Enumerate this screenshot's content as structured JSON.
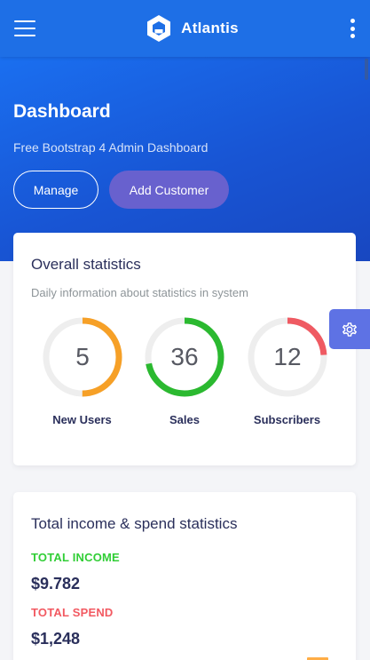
{
  "navbar": {
    "brand": "Atlantis",
    "menu_icon": "hamburger-menu-icon",
    "more_icon": "more-vertical-icon",
    "logo_icon": "atlantis-logo-icon",
    "color": "#1e6fe6"
  },
  "hero": {
    "title": "Dashboard",
    "subtitle": "Free Bootstrap 4 Admin Dashboard",
    "manage_label": "Manage",
    "add_customer_label": "Add Customer"
  },
  "stats_card": {
    "title": "Overall statistics",
    "subtitle": "Daily information about statistics in system",
    "items": [
      {
        "value": "5",
        "label": "New Users",
        "color": "#f6a027",
        "fill": 0.5
      },
      {
        "value": "36",
        "label": "Sales",
        "color": "#2bb930",
        "fill": 0.72
      },
      {
        "value": "12",
        "label": "Subscribers",
        "color": "#ef5a62",
        "fill": 0.24
      }
    ]
  },
  "income_card": {
    "title": "Total income & spend statistics",
    "income_label": "TOTAL INCOME",
    "income_value": "$9.782",
    "spend_label": "TOTAL SPEND",
    "spend_value": "$1,248"
  },
  "settings": {
    "icon": "gear-icon",
    "color": "#5e72e4"
  }
}
